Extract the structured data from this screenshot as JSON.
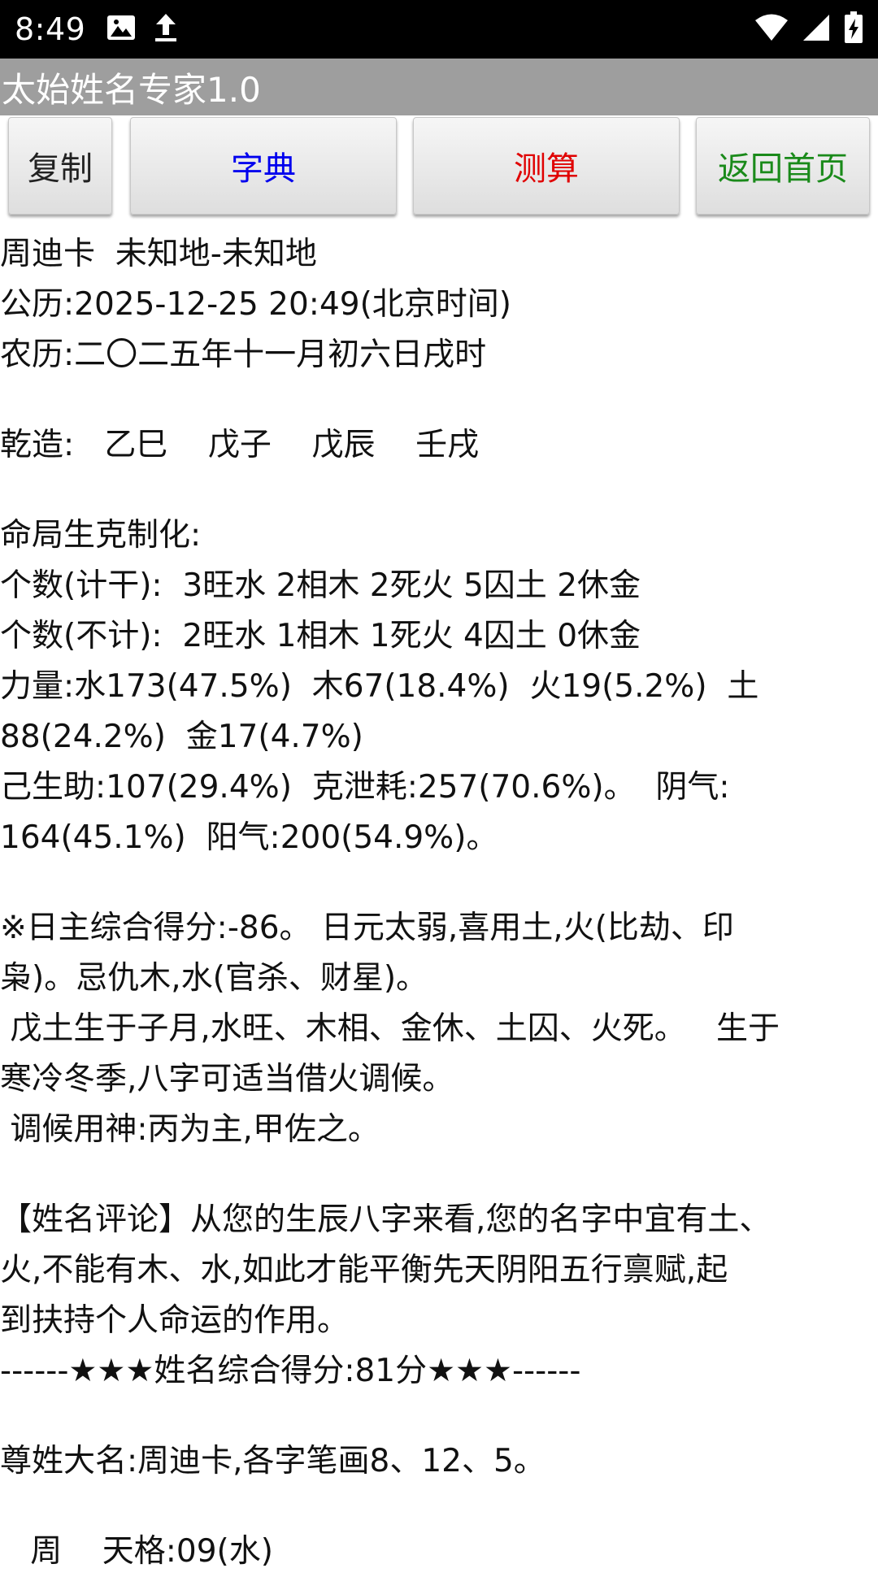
{
  "status_bar": {
    "time": "8:49"
  },
  "app": {
    "title": "太始姓名专家1.0"
  },
  "toolbar": {
    "copy": "复制",
    "dictionary": "字典",
    "calculate": "测算",
    "home": "返回首页"
  },
  "colors": {
    "dictionary": "#0000ee",
    "calculate": "#e00000",
    "home": "#1a8a1a"
  },
  "content": {
    "header_lines": [
      "周迪卡  未知地-未知地",
      "公历:2025-12-25 20:49(北京时间)",
      "农历:二〇二五年十一月初六日戌时"
    ],
    "bazi_line": "乾造:   乙巳    戊子    戊辰    壬戌",
    "analysis_lines": [
      "命局生克制化:",
      "个数(计干):  3旺水 2相木 2死火 5囚土 2休金",
      "个数(不计):  2旺水 1相木 1死火 4囚土 0休金",
      "力量:水173(47.5%)  木67(18.4%)  火19(5.2%)  土",
      "88(24.2%)  金17(4.7%)",
      "己生助:107(29.4%)  克泄耗:257(70.6%)。  阴气:",
      "164(45.1%)  阳气:200(54.9%)。"
    ],
    "score_lines": [
      "※日主综合得分:-86。 日元太弱,喜用土,火(比劫、印",
      "枭)。忌仇木,水(官杀、财星)。",
      " 戊土生于子月,水旺、木相、金休、土囚、火死。   生于",
      "寒冷冬季,八字可适当借火调候。",
      " 调候用神:丙为主,甲佐之。"
    ],
    "comment_lines": [
      "【姓名评论】从您的生辰八字来看,您的名字中宜有土、",
      "火,不能有木、水,如此才能平衡先天阴阳五行禀赋,起",
      "到扶持个人命运的作用。",
      "------★★★姓名综合得分:81分★★★------"
    ],
    "name_lines": [
      "尊姓大名:周迪卡,各字笔画8、12、5。"
    ],
    "last_line": "   周    天格:09(水)"
  }
}
